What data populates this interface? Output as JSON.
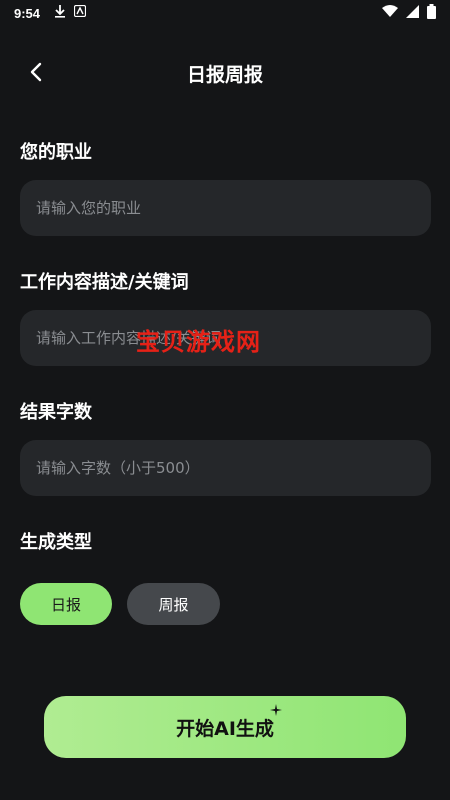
{
  "status_bar": {
    "time": "9:54",
    "icons": [
      "download-icon",
      "app-notification-icon",
      "wifi-icon",
      "signal-icon",
      "battery-icon"
    ]
  },
  "header": {
    "title": "日报周报",
    "back_icon": "chevron-left-icon"
  },
  "form": {
    "occupation": {
      "label": "您的职业",
      "placeholder": "请输入您的职业",
      "value": ""
    },
    "description": {
      "label": "工作内容描述/关键词",
      "placeholder": "请输入工作内容描述/关键词",
      "value": ""
    },
    "word_count": {
      "label": "结果字数",
      "placeholder": "请输入字数（小于500）",
      "value": ""
    },
    "type": {
      "label": "生成类型",
      "options": [
        "日报",
        "周报"
      ],
      "selected": "日报"
    }
  },
  "watermark": "宝贝游戏网",
  "action": {
    "generate_label": "开始AI生成",
    "sparkle_icon": "sparkle-icon"
  },
  "colors": {
    "background": "#141517",
    "input_bg": "#25272a",
    "accent": "#8fe573",
    "chip_inactive": "#45484c",
    "watermark": "#e62117"
  }
}
